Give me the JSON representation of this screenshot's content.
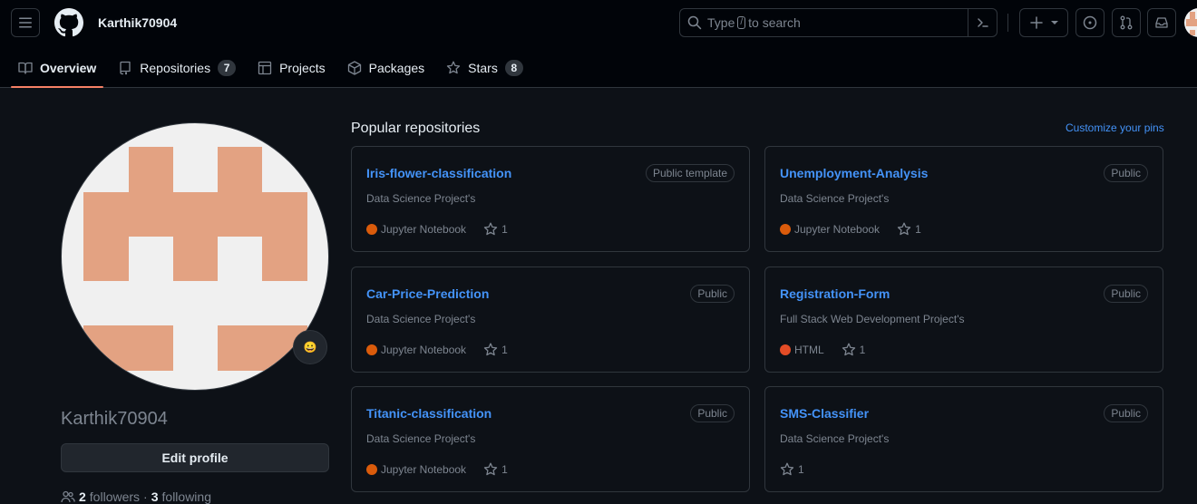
{
  "header": {
    "username": "Karthik70904",
    "search": {
      "prefix": "Type",
      "key": "/",
      "suffix": "to search"
    }
  },
  "tabs": [
    {
      "label": "Overview",
      "count": null,
      "icon": "book-icon"
    },
    {
      "label": "Repositories",
      "count": "7",
      "icon": "repo-icon"
    },
    {
      "label": "Projects",
      "count": null,
      "icon": "table-icon"
    },
    {
      "label": "Packages",
      "count": null,
      "icon": "package-icon"
    },
    {
      "label": "Stars",
      "count": "8",
      "icon": "star-icon"
    }
  ],
  "profile": {
    "name": "Karthik70904",
    "edit_label": "Edit profile",
    "followers_count": "2",
    "followers_label": "followers",
    "separator": "·",
    "following_count": "3",
    "following_label": "following",
    "emoji": "😀"
  },
  "pinned": {
    "title": "Popular repositories",
    "customize_label": "Customize your pins",
    "repos": [
      {
        "name": "Iris-flower-classification",
        "badge": "Public template",
        "desc": "Data Science Project's",
        "lang": "Jupyter Notebook",
        "lang_color": "#DA5B0B",
        "stars": "1"
      },
      {
        "name": "Unemployment-Analysis",
        "badge": "Public",
        "desc": "Data Science Project's",
        "lang": "Jupyter Notebook",
        "lang_color": "#DA5B0B",
        "stars": "1"
      },
      {
        "name": "Car-Price-Prediction",
        "badge": "Public",
        "desc": "Data Science Project's",
        "lang": "Jupyter Notebook",
        "lang_color": "#DA5B0B",
        "stars": "1"
      },
      {
        "name": "Registration-Form",
        "badge": "Public",
        "desc": "Full Stack Web Development Project's",
        "lang": "HTML",
        "lang_color": "#e34c26",
        "stars": "1"
      },
      {
        "name": "Titanic-classification",
        "badge": "Public",
        "desc": "Data Science Project's",
        "lang": "Jupyter Notebook",
        "lang_color": "#DA5B0B",
        "stars": "1"
      },
      {
        "name": "SMS-Classifier",
        "badge": "Public",
        "desc": "Data Science Project's",
        "lang": "",
        "lang_color": "",
        "stars": "1"
      }
    ]
  },
  "colors": {
    "accent": "#4493f8",
    "tab_underline": "#f78166",
    "identicon": "#e3a282"
  }
}
